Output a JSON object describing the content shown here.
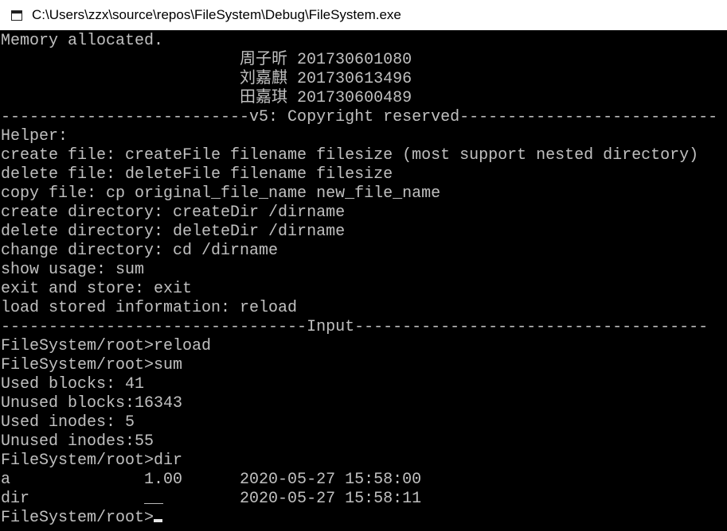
{
  "window": {
    "title": "C:\\Users\\zzx\\source\\repos\\FileSystem\\Debug\\FileSystem.exe",
    "icon": "console-window-icon"
  },
  "console": {
    "text_color": "#c0c0c0",
    "background": "#000000",
    "lines": [
      "Memory allocated.",
      "                         周子昕 201730601080",
      "                         刘嘉麒 201730613496",
      "                         田嘉琪 201730600489",
      "--------------------------v5: Copyright reserved---------------------------",
      "Helper:",
      "create file: createFile filename filesize (most support nested directory)",
      "delete file: deleteFile filename filesize",
      "copy file: cp original_file_name new_file_name",
      "create directory: createDir /dirname",
      "delete directory: deleteDir /dirname",
      "change directory: cd /dirname",
      "show usage: sum",
      "exit and store: exit",
      "load stored information: reload",
      "--------------------------------Input-------------------------------------",
      "FileSystem/root>reload",
      "FileSystem/root>sum",
      "Used blocks: 41",
      "Unused blocks:16343",
      "Used inodes: 5",
      "Unused inodes:55",
      "FileSystem/root>dir",
      "a              1.00      2020-05-27 15:58:00",
      "dir            __        2020-05-27 15:58:11"
    ],
    "prompt": "FileSystem/root>"
  }
}
